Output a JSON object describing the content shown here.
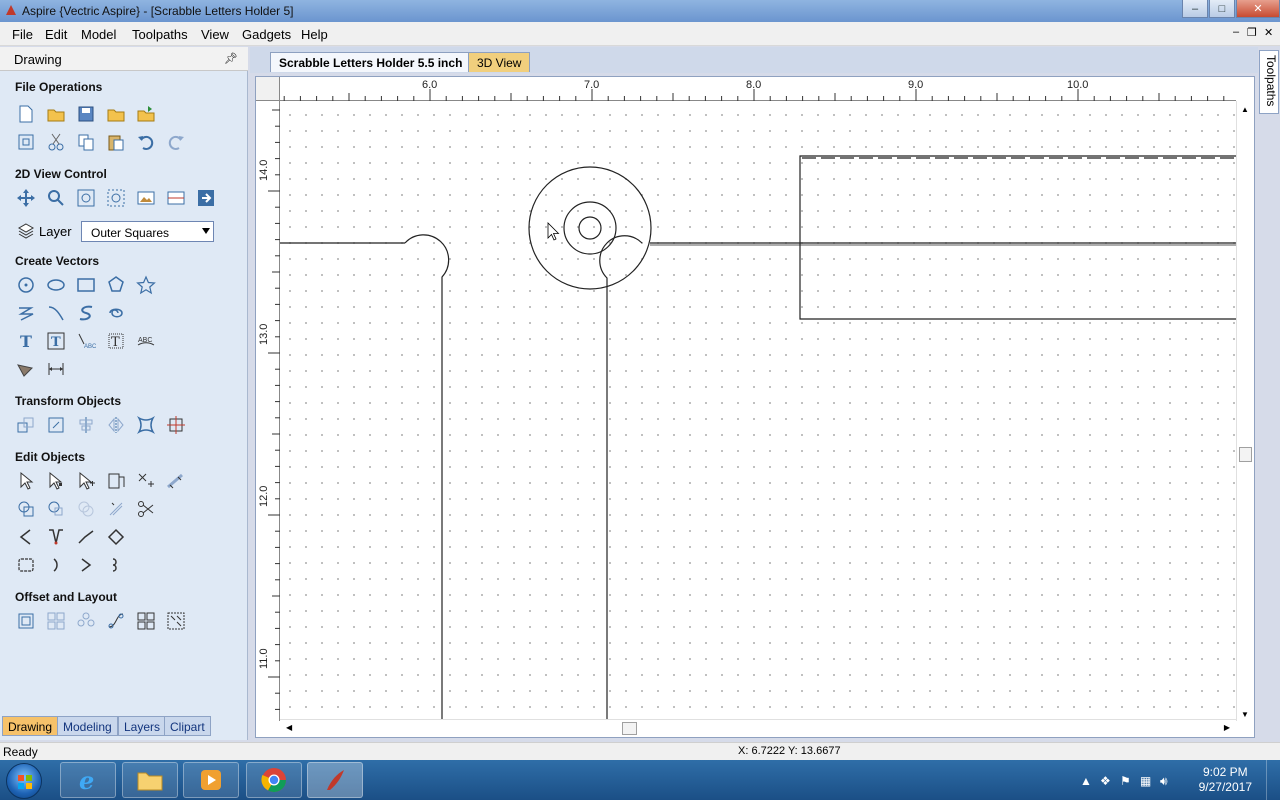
{
  "window": {
    "title": "Aspire {Vectric Aspire} - [Scrabble Letters Holder 5]"
  },
  "menu": {
    "items": [
      "File",
      "Edit",
      "Model",
      "Toolpaths",
      "View",
      "Gadgets",
      "Help"
    ]
  },
  "panel": {
    "title": "Drawing",
    "sections": {
      "file_operations": "File Operations",
      "view_control": "2D View Control",
      "create_vectors": "Create Vectors",
      "transform_objects": "Transform Objects",
      "edit_objects": "Edit Objects",
      "offset_layout": "Offset and Layout"
    },
    "layer_label": "Layer",
    "layer_value": "Outer Squares",
    "bottom_tabs": [
      "Drawing",
      "Modeling",
      "Layers",
      "Clipart"
    ]
  },
  "doc_tabs": {
    "active": "Scrabble Letters Holder 5.5 inch",
    "other": "3D View"
  },
  "ruler": {
    "h_labels": [
      "6.0",
      "7.0",
      "8.0",
      "9.0",
      "10.0"
    ],
    "v_labels": [
      "14.0",
      "13.0",
      "12.0",
      "11.0"
    ]
  },
  "right_tab": "Toolpaths",
  "status": {
    "text": "Ready",
    "coords": "X: 6.7222 Y: 13.6677"
  },
  "taskbar": {
    "time": "9:02 PM",
    "date": "9/27/2017"
  }
}
